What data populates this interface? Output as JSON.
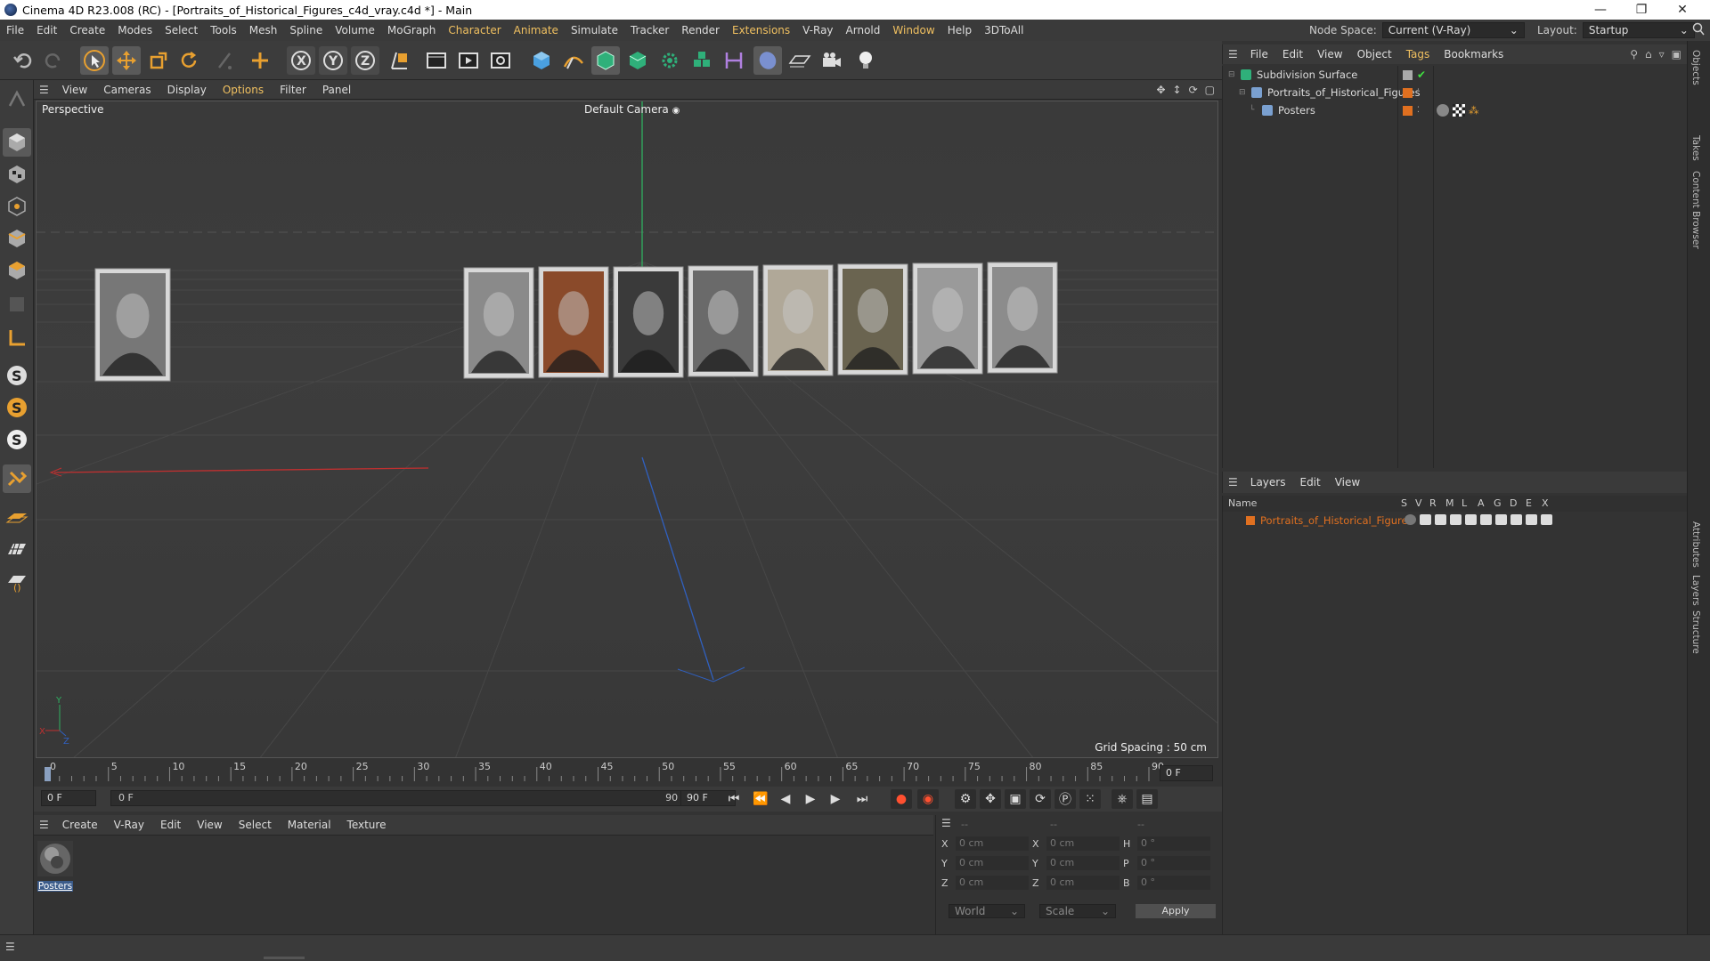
{
  "window": {
    "title": "Cinema 4D R23.008 (RC) - [Portraits_of_Historical_Figures_c4d_vray.c4d *] - Main",
    "controls": [
      "minimize-icon",
      "restore-icon",
      "close-icon"
    ]
  },
  "menubar": {
    "items": [
      "File",
      "Edit",
      "Create",
      "Modes",
      "Select",
      "Tools",
      "Mesh",
      "Spline",
      "Volume",
      "MoGraph",
      "Character",
      "Animate",
      "Simulate",
      "Tracker",
      "Render",
      "Extensions",
      "V-Ray",
      "Arnold",
      "Window",
      "Help",
      "3DToAll"
    ],
    "highlighted": [
      "Character",
      "Animate",
      "Extensions",
      "Window"
    ],
    "node_space_label": "Node Space:",
    "node_space_value": "Current (V-Ray)",
    "layout_label": "Layout:",
    "layout_value": "Startup"
  },
  "toolbar": {
    "icons": [
      "undo-icon",
      "redo-icon",
      "select-arrow-icon",
      "move-icon",
      "scale-icon",
      "rotate-icon",
      "recent-tool-icon",
      "add-icon",
      "x-axis-icon",
      "y-axis-icon",
      "z-axis-icon",
      "coordinate-system-icon",
      "render-view-icon",
      "render-picture-viewer-icon",
      "render-settings-icon",
      "cube-icon",
      "spline-pen-icon",
      "subdivision-icon",
      "extrude-icon",
      "cloner-icon",
      "field-icon",
      "deformer-icon",
      "scene-icon",
      "floor-icon",
      "camera-icon",
      "light-icon"
    ]
  },
  "left_tools": {
    "icons": [
      "make-editable-icon",
      "model-mode-icon",
      "texture-mode-icon",
      "points-mode-icon",
      "edges-mode-icon",
      "polygons-mode-icon",
      "workplane-icon",
      "axis-icon",
      "snap-s-icon",
      "snap-settings-icon",
      "soft-selection-icon",
      "magnet-icon",
      "floor-grid-icon",
      "grid-icon",
      "workplane-lock-icon"
    ]
  },
  "viewport": {
    "menu": [
      "View",
      "Cameras",
      "Display",
      "Options",
      "Filter",
      "Panel"
    ],
    "menu_highlighted": [
      "Options"
    ],
    "view_label": "Perspective",
    "camera_label": "Default Camera",
    "grid_spacing": "Grid Spacing : 50 cm",
    "corner_icons": [
      "pan-icon",
      "zoom-icon",
      "rotate-view-icon",
      "maximize-icon"
    ],
    "axis_labels": {
      "x": "X",
      "y": "Y",
      "z": "Z"
    },
    "posters": [
      {
        "name": "portrait-1",
        "tone": "#777777"
      },
      {
        "name": "portrait-2",
        "tone": "#8a8a8a"
      },
      {
        "name": "portrait-3",
        "tone": "#8a4a2a"
      },
      {
        "name": "portrait-4",
        "tone": "#3a3a3a"
      },
      {
        "name": "portrait-5",
        "tone": "#6a6a6a"
      },
      {
        "name": "portrait-6",
        "tone": "#b0a898"
      },
      {
        "name": "portrait-7",
        "tone": "#6a6450"
      },
      {
        "name": "portrait-8",
        "tone": "#9a9a9a"
      },
      {
        "name": "portrait-9",
        "tone": "#8c8c8c"
      }
    ]
  },
  "timeline": {
    "ticks": [
      "0",
      "5",
      "10",
      "15",
      "20",
      "25",
      "30",
      "35",
      "40",
      "45",
      "50",
      "55",
      "60",
      "65",
      "70",
      "75",
      "80",
      "85",
      "90"
    ],
    "current_frame": "0 F",
    "start_field": "0 F",
    "range_start": "0 F",
    "range_end": "90 F",
    "end_field": "90 F",
    "frame_out": "0 F"
  },
  "transport": {
    "icons": [
      "go-to-start-icon",
      "step-back-key-icon",
      "step-back-icon",
      "play-icon",
      "step-forward-icon",
      "go-to-end-icon",
      "record-icon",
      "autokey-icon",
      "keyframe-selection-icon",
      "move-key-icon",
      "scale-key-icon",
      "rotate-key-icon",
      "param-key-icon",
      "pla-key-icon",
      "motion-system-icon",
      "timeline-window-icon"
    ]
  },
  "material_manager": {
    "menu": [
      "Create",
      "V-Ray",
      "Edit",
      "View",
      "Select",
      "Material",
      "Texture"
    ],
    "materials": [
      {
        "name": "Posters"
      }
    ]
  },
  "coordinates": {
    "headers": [
      "--",
      "--",
      "--"
    ],
    "rows": [
      {
        "axis": "X",
        "pos": "0 cm",
        "axis2": "X",
        "size": "0 cm",
        "axis3": "H",
        "rot": "0 °"
      },
      {
        "axis": "Y",
        "pos": "0 cm",
        "axis2": "Y",
        "size": "0 cm",
        "axis3": "P",
        "rot": "0 °"
      },
      {
        "axis": "Z",
        "pos": "0 cm",
        "axis2": "Z",
        "size": "0 cm",
        "axis3": "B",
        "rot": "0 °"
      }
    ],
    "world_select": "World",
    "scale_select": "Scale",
    "apply_label": "Apply"
  },
  "object_manager": {
    "menu": [
      "File",
      "Edit",
      "View",
      "Object",
      "Tags",
      "Bookmarks"
    ],
    "menu_highlighted": [
      "Tags"
    ],
    "objects": [
      {
        "name": "Subdivision Surface",
        "indent": 0,
        "icon": "subdivision-surface-icon"
      },
      {
        "name": "Portraits_of_Historical_Figures",
        "indent": 1,
        "icon": "null-object-icon"
      },
      {
        "name": "Posters",
        "indent": 2,
        "icon": "polygon-object-icon"
      }
    ]
  },
  "layers": {
    "menu": [
      "Layers",
      "Edit",
      "View"
    ],
    "columns": [
      "Name",
      "S",
      "V",
      "R",
      "M",
      "L",
      "A",
      "G",
      "D",
      "E",
      "X"
    ],
    "rows": [
      {
        "name": "Portraits_of_Historical_Figures",
        "color": "#e07020"
      }
    ]
  },
  "side_tabs": [
    "Objects",
    "Takes",
    "Content Browser",
    "Attributes",
    "Layers",
    "Structure"
  ],
  "colors": {
    "accent": "#f0c060",
    "layer": "#e07020",
    "x_axis": "#c03030",
    "y_axis": "#30c060",
    "z_axis": "#3060c0"
  }
}
